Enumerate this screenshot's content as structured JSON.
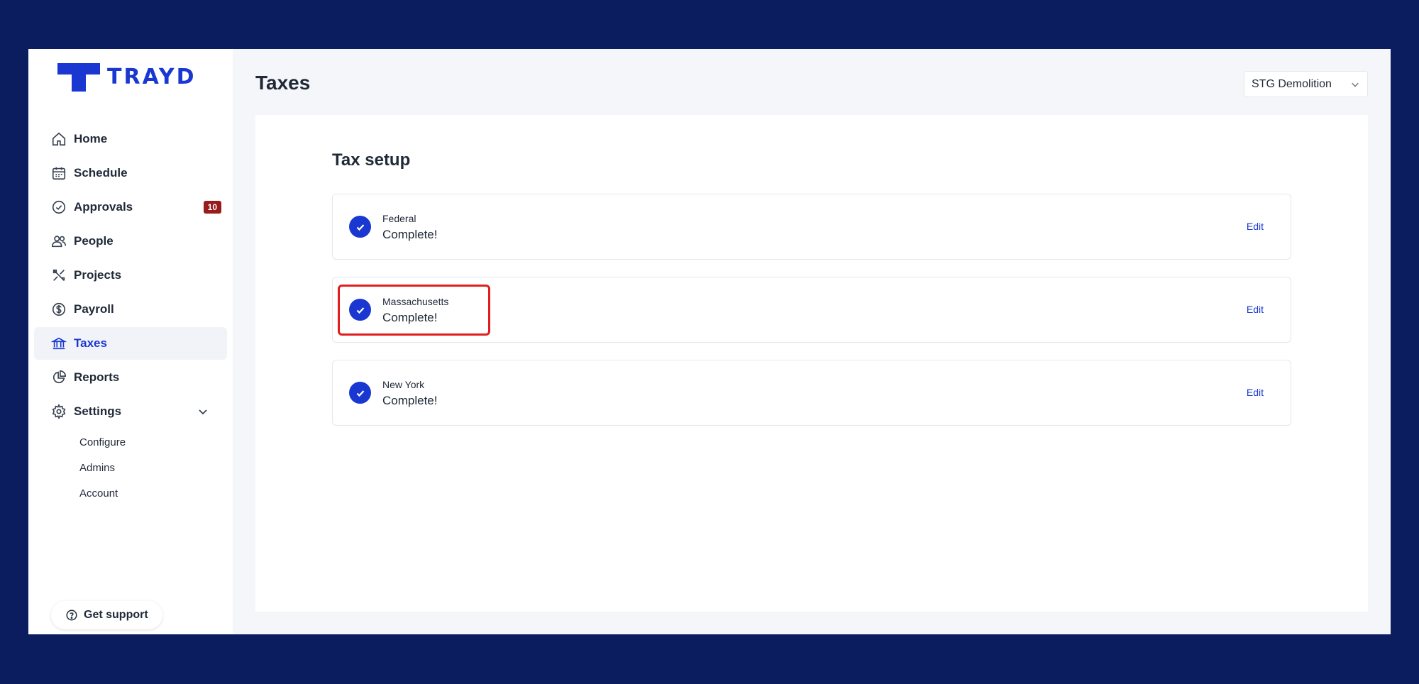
{
  "brand": {
    "name": "TRAYD",
    "accent": "#1a38d1"
  },
  "nav": {
    "items": [
      {
        "label": "Home",
        "icon": "home-icon"
      },
      {
        "label": "Schedule",
        "icon": "calendar-icon"
      },
      {
        "label": "Approvals",
        "icon": "check-circle-icon",
        "badge": "10"
      },
      {
        "label": "People",
        "icon": "people-icon"
      },
      {
        "label": "Projects",
        "icon": "tools-icon"
      },
      {
        "label": "Payroll",
        "icon": "dollar-icon"
      },
      {
        "label": "Taxes",
        "icon": "bank-icon",
        "active": true
      },
      {
        "label": "Reports",
        "icon": "pie-chart-icon"
      },
      {
        "label": "Settings",
        "icon": "gear-icon",
        "expanded": true
      }
    ],
    "settings_sub": [
      "Configure",
      "Admins",
      "Account"
    ]
  },
  "support": {
    "label": "Get support",
    "icon": "help-circle-icon"
  },
  "header": {
    "title": "Taxes",
    "company": "STG Demolition"
  },
  "tax_setup": {
    "title": "Tax setup",
    "rows": [
      {
        "name": "Federal",
        "status": "Complete!",
        "action": "Edit"
      },
      {
        "name": "Massachusetts",
        "status": "Complete!",
        "action": "Edit",
        "highlighted": true
      },
      {
        "name": "New York",
        "status": "Complete!",
        "action": "Edit"
      }
    ]
  }
}
